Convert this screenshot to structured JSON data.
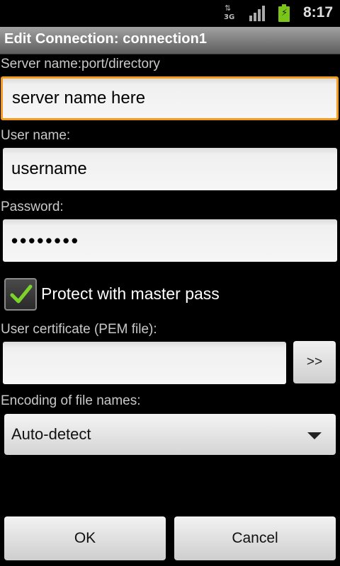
{
  "statusbar": {
    "network_type": "3G",
    "network_icon": "3g-data-icon",
    "signal_icon": "signal-strength-icon",
    "battery_icon": "battery-charging-icon",
    "time": "8:17"
  },
  "dialog": {
    "title": "Edit Connection: connection1"
  },
  "form": {
    "server_label": "Server name:port/directory",
    "server_value": "server name here",
    "user_label": "User name:",
    "user_value": "username",
    "password_label": "Password:",
    "password_value": "••••••••",
    "protect_label": "Protect with master pass",
    "protect_checked": true,
    "cert_label": "User certificate (PEM file):",
    "cert_value": "",
    "browse_label": ">>",
    "encoding_label": "Encoding of file names:",
    "encoding_value": "Auto-detect"
  },
  "buttons": {
    "ok": "OK",
    "cancel": "Cancel"
  },
  "colors": {
    "focus": "#f59b1d",
    "check": "#7cd42a"
  }
}
